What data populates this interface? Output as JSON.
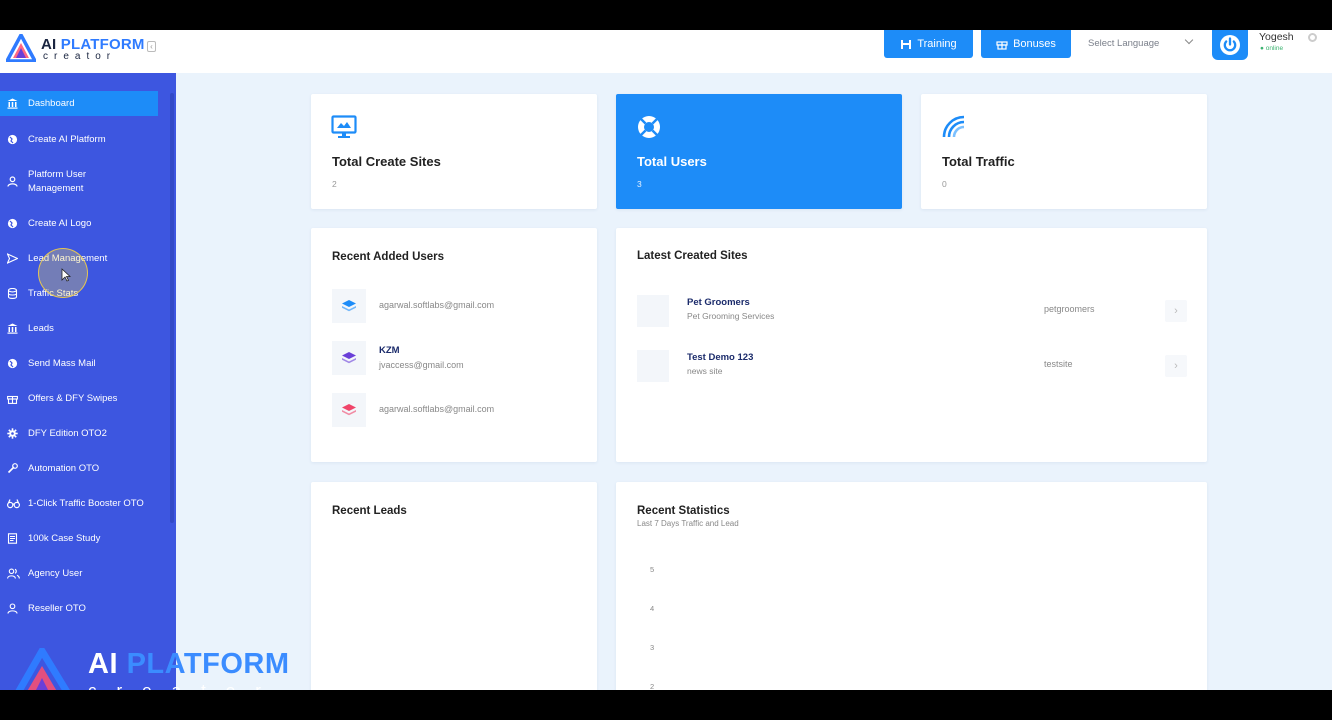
{
  "app": {
    "logo_main": "AI",
    "logo_accent": "PLATFORM",
    "logo_sub": "creator"
  },
  "topbar": {
    "training_label": "Training",
    "bonuses_label": "Bonuses",
    "language_label": "Select Language",
    "user_name": "Yogesh",
    "user_status": "● online"
  },
  "sidebar": {
    "items": [
      {
        "label": "Dashboard",
        "icon": "bank-icon"
      },
      {
        "label": "Create AI Platform",
        "icon": "globe-icon"
      },
      {
        "label": "Platform User Management",
        "icon": "user-icon"
      },
      {
        "label": "Create AI Logo",
        "icon": "globe-icon"
      },
      {
        "label": "Lead Management",
        "icon": "send-icon"
      },
      {
        "label": "Traffic Stats",
        "icon": "database-icon"
      },
      {
        "label": "Leads",
        "icon": "bank-icon"
      },
      {
        "label": "Send Mass Mail",
        "icon": "globe-icon"
      },
      {
        "label": "Offers & DFY Swipes",
        "icon": "gift-icon"
      },
      {
        "label": "DFY Edition OTO2",
        "icon": "gear-icon"
      },
      {
        "label": "Automation OTO",
        "icon": "tools-icon"
      },
      {
        "label": "1-Click Traffic Booster OTO",
        "icon": "binoculars-icon"
      },
      {
        "label": "100k Case Study",
        "icon": "document-icon"
      },
      {
        "label": "Agency User",
        "icon": "users-icon"
      },
      {
        "label": "Reseller OTO",
        "icon": "user-switch-icon"
      }
    ]
  },
  "stats": [
    {
      "title": "Total Create Sites",
      "value": "2"
    },
    {
      "title": "Total Users",
      "value": "3"
    },
    {
      "title": "Total Traffic",
      "value": "0"
    }
  ],
  "recent_users": {
    "title": "Recent Added Users",
    "items": [
      {
        "name": "",
        "email": "agarwal.softlabs@gmail.com",
        "color": "#1d8cf8"
      },
      {
        "name": "KZM",
        "email": "jvaccess@gmail.com",
        "color": "#6a3fd8"
      },
      {
        "name": "",
        "email": "agarwal.softlabs@gmail.com",
        "color": "#f0456a"
      }
    ]
  },
  "latest_sites": {
    "title": "Latest Created Sites",
    "items": [
      {
        "name": "Pet Groomers",
        "desc": "Pet Grooming Services",
        "slug": "petgroomers"
      },
      {
        "name": "Test Demo 123",
        "desc": "news site",
        "slug": "testsite"
      }
    ]
  },
  "recent_leads": {
    "title": "Recent Leads"
  },
  "recent_statistics": {
    "title": "Recent Statistics",
    "subtitle": "Last 7 Days Traffic and Lead",
    "y_ticks": [
      "5",
      "4",
      "3",
      "2"
    ]
  },
  "colors": {
    "sidebar": "#3d56e0",
    "accent": "#1d8cf8",
    "background": "#eaf3fc"
  }
}
